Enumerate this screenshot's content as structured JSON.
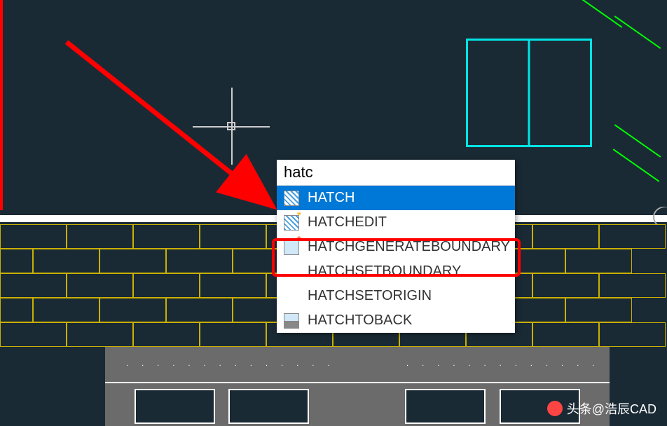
{
  "autocomplete": {
    "input_value": "hatc",
    "items": [
      {
        "label": "HATCH",
        "icon": "icon-hatch",
        "selected": true
      },
      {
        "label": "HATCHEDIT",
        "icon": "icon-edit",
        "selected": false
      },
      {
        "label": "HATCHGENERATEBOUNDARY",
        "icon": "icon-gen",
        "selected": false
      },
      {
        "label": "HATCHSETBOUNDARY",
        "icon": "blank",
        "selected": false
      },
      {
        "label": "HATCHSETORIGIN",
        "icon": "blank",
        "selected": false
      },
      {
        "label": "HATCHTOBACK",
        "icon": "icon-back",
        "selected": false
      }
    ]
  },
  "watermark": {
    "prefix": "头条",
    "text": "@浩辰CAD"
  }
}
